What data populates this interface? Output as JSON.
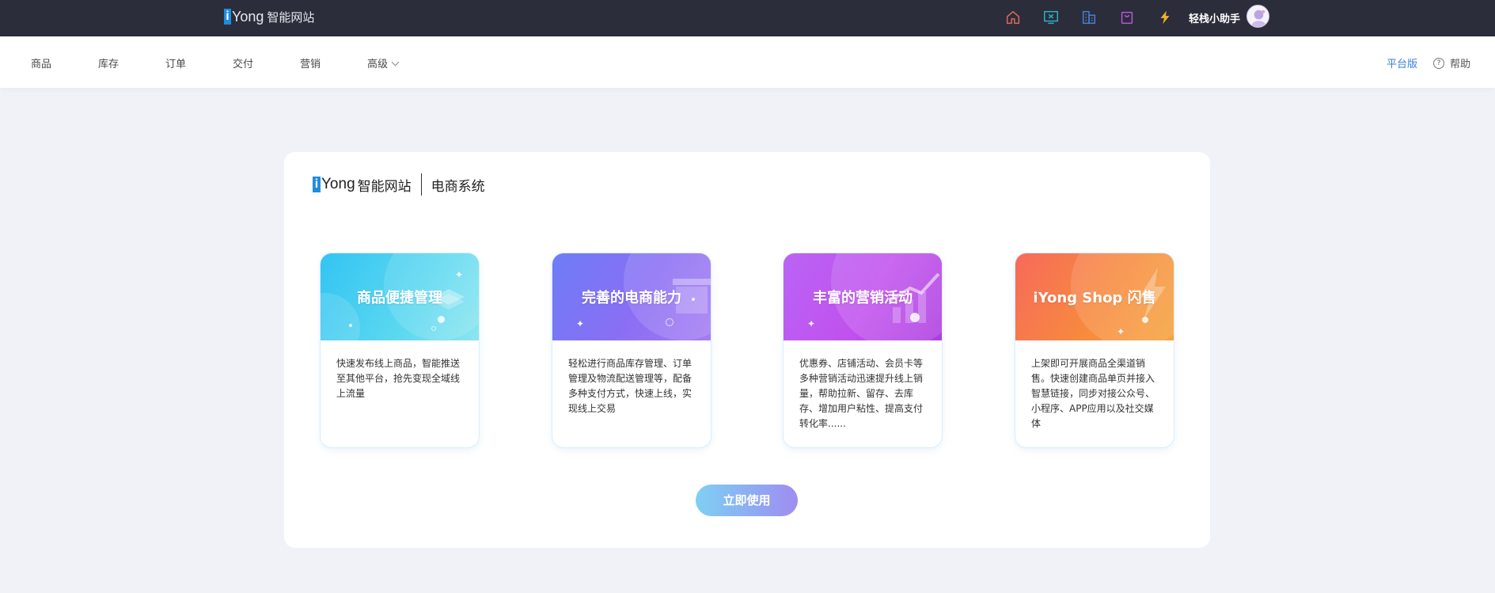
{
  "topbar": {
    "brand_i": "i",
    "brand_yong": "Yong",
    "brand_cn": "智能网站",
    "icons": [
      "home-icon",
      "monitor-icon",
      "building-icon",
      "bag-icon",
      "lightning-icon"
    ],
    "user_name": "轻栈小助手"
  },
  "nav": {
    "items": [
      "商品",
      "库存",
      "订单",
      "交付",
      "营销",
      "高级"
    ],
    "platform": "平台版",
    "help": "帮助"
  },
  "panel": {
    "brand_i": "i",
    "brand_yong": "Yong",
    "brand_cn": "智能网站",
    "system": "电商系统",
    "cards": [
      {
        "title": "商品便捷管理",
        "desc": "快速发布线上商品，智能推送至其他平台，抢先变现全域线上流量"
      },
      {
        "title": "完善的电商能力",
        "desc": "轻松进行商品库存管理、订单管理及物流配送管理等，配备多种支付方式，快速上线，实现线上交易"
      },
      {
        "title": "丰富的营销活动",
        "desc": "优惠券、店铺活动、会员卡等多种营销活动迅速提升线上销量，帮助拉新、留存、去库存、增加用户粘性、提高支付转化率......"
      },
      {
        "title": "iYong Shop 闪售",
        "desc": "上架即可开展商品全渠道销售。快速创建商品单页并接入智慧链接，同步对接公众号、小程序、APP应用以及社交媒体"
      }
    ],
    "cta": "立即使用"
  },
  "colors": {
    "topbar_bg": "#2b2d3a",
    "page_bg": "#f0f2f7",
    "accent_blue": "#3a7fd9"
  }
}
